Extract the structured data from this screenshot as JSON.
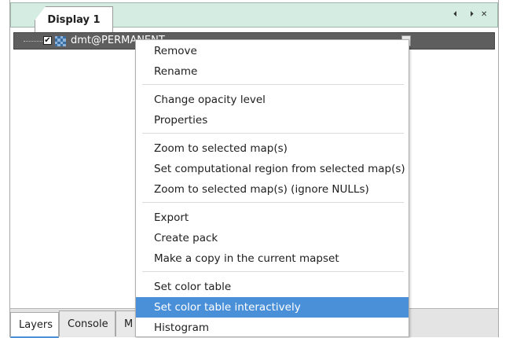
{
  "notebook": {
    "tab_label": "Display 1",
    "controls": {
      "prev": "⏴",
      "next": "⏵",
      "close": "✕"
    }
  },
  "layer_tree": {
    "layer": {
      "name": "dmt@PERMANENT",
      "checked": true,
      "check_glyph": "✔"
    }
  },
  "bottom_tabs": [
    {
      "label": "Layers",
      "active": true
    },
    {
      "label": "Console",
      "active": false
    },
    {
      "label": "M",
      "active": false
    }
  ],
  "context_menu": {
    "items": [
      "Remove",
      "Rename",
      "Change opacity level",
      "Properties",
      "Zoom to selected map(s)",
      "Set computational region from selected map(s)",
      "Zoom to selected map(s) (ignore NULLs)",
      "Export",
      "Create pack",
      "Make a copy in the current mapset",
      "Set color table",
      "Set color table interactively",
      "Histogram"
    ],
    "highlighted_index": 11,
    "highlight_color": "#4a90d9"
  }
}
